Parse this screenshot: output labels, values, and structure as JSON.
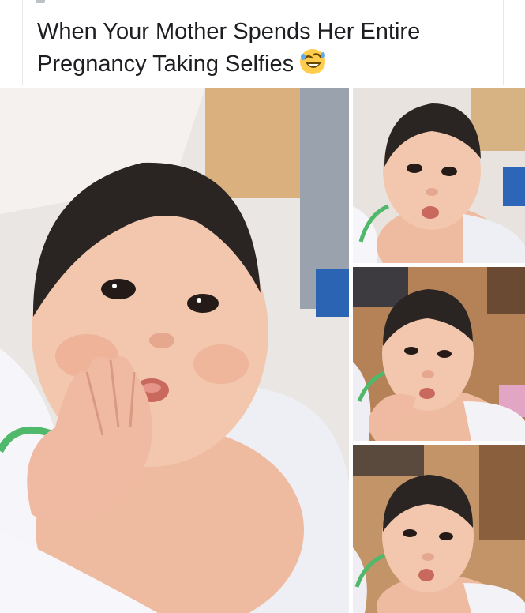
{
  "post": {
    "caption": "When Your Mother Spends Her Entire Pregnancy Taking Selfies",
    "emoji": "rolling-on-floor-laughing-emoji"
  },
  "photos": [
    {
      "name": "baby-photo-main",
      "subject": "baby-face-closeup"
    },
    {
      "name": "baby-photo-1",
      "subject": "baby-face"
    },
    {
      "name": "baby-photo-2",
      "subject": "baby-face"
    },
    {
      "name": "baby-photo-3",
      "subject": "baby-face"
    }
  ],
  "colors": {
    "skin": "#f2c7ae",
    "skin_shadow": "#dfa88d",
    "hair": "#2a2422",
    "blanket": "#f1f2f7",
    "background_wood": "#b48256",
    "green_tube": "#4fb86a"
  }
}
